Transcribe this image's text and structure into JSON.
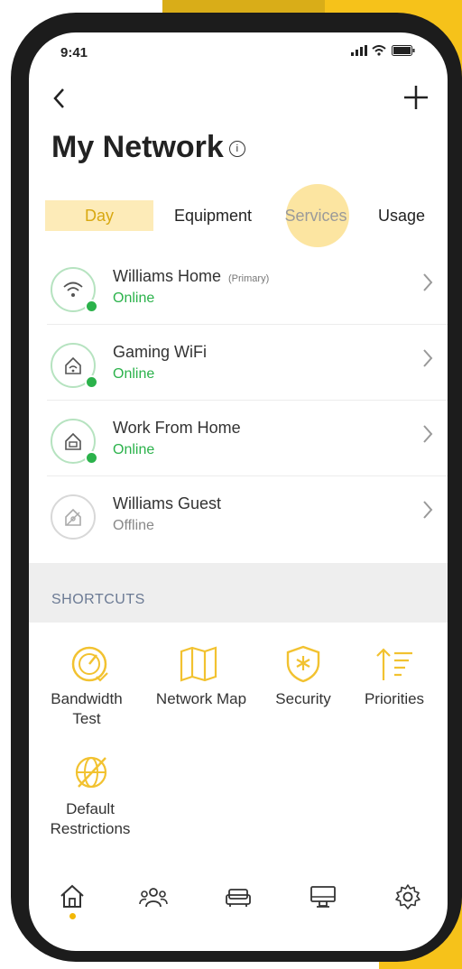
{
  "status_bar": {
    "time": "9:41",
    "signal_icon": "signal-icon",
    "wifi_icon": "wifi-icon",
    "battery_icon": "battery-icon"
  },
  "header": {
    "back_icon": "chevron-left-icon",
    "add_icon": "plus-icon",
    "title": "My Network",
    "info_icon": "info-icon"
  },
  "tabs": [
    {
      "label": "Day",
      "active": true
    },
    {
      "label": "Equipment",
      "active": false
    },
    {
      "label": "Services",
      "active": false
    },
    {
      "label": "Usage",
      "active": false
    }
  ],
  "networks": [
    {
      "name": "Williams Home",
      "tag": "(Primary)",
      "status": "Online",
      "online": true,
      "icon": "wifi-icon"
    },
    {
      "name": "Gaming WiFi",
      "tag": "",
      "status": "Online",
      "online": true,
      "icon": "home-wifi-icon"
    },
    {
      "name": "Work From Home",
      "tag": "",
      "status": "Online",
      "online": true,
      "icon": "home-laptop-icon"
    },
    {
      "name": "Williams Guest",
      "tag": "",
      "status": "Offline",
      "online": false,
      "icon": "home-guest-icon"
    }
  ],
  "shortcuts": {
    "label": "SHORTCUTS",
    "items": [
      {
        "label_line1": "Bandwidth",
        "label_line2": "Test",
        "icon": "speedometer-icon"
      },
      {
        "label_line1": "Network Map",
        "label_line2": "",
        "icon": "map-icon"
      },
      {
        "label_line1": "Security",
        "label_line2": "",
        "icon": "shield-icon"
      },
      {
        "label_line1": "Priorities",
        "label_line2": "",
        "icon": "priorities-icon"
      },
      {
        "label_line1": "Default",
        "label_line2": "Restrictions",
        "icon": "restricted-globe-icon"
      }
    ]
  },
  "bottom_nav": [
    {
      "icon": "home-icon",
      "active": true
    },
    {
      "icon": "people-icon",
      "active": false
    },
    {
      "icon": "couch-icon",
      "active": false
    },
    {
      "icon": "monitor-icon",
      "active": false
    },
    {
      "icon": "gear-icon",
      "active": false
    }
  ],
  "colors": {
    "accent": "#f2b705",
    "online": "#2bb24b",
    "tab_highlight": "#fdebb8",
    "shortcut_icon": "#f2c230"
  }
}
